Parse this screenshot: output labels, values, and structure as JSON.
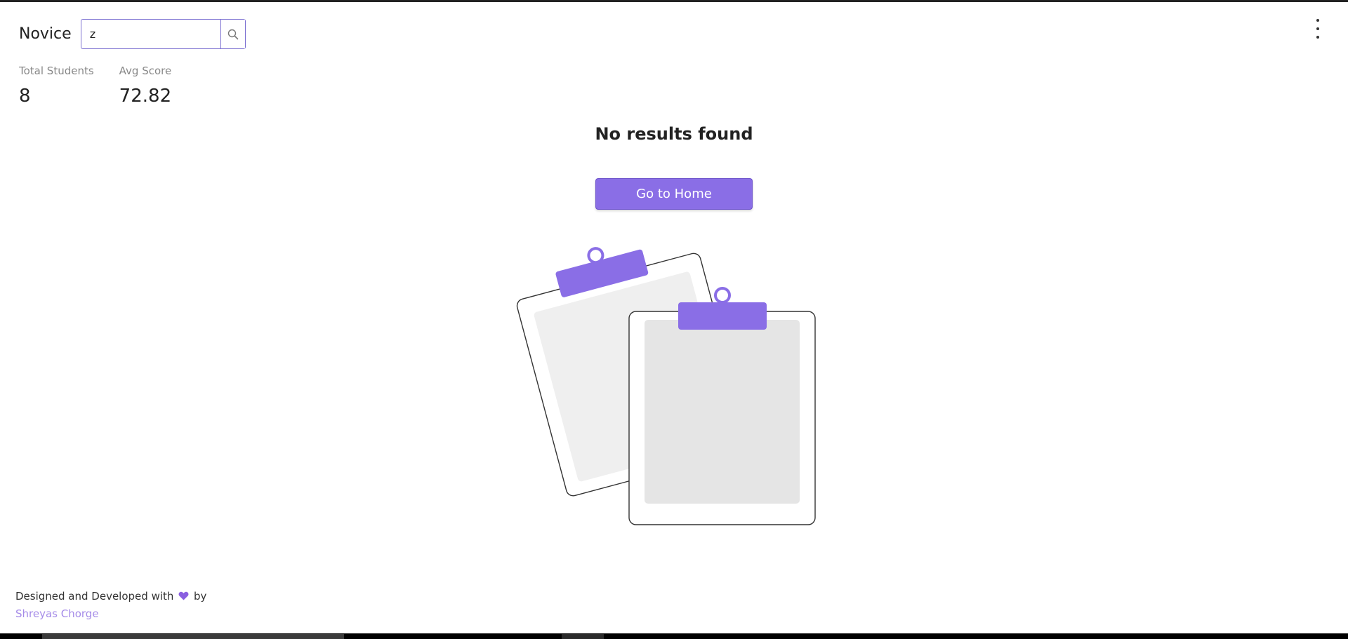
{
  "header": {
    "brand": "Novice",
    "search": {
      "value": "z",
      "placeholder": ""
    }
  },
  "stats": [
    {
      "label": "Total Students",
      "value": "8"
    },
    {
      "label": "Avg Score",
      "value": "72.82"
    }
  ],
  "empty_state": {
    "title": "No results found",
    "button_label": "Go to Home"
  },
  "footer": {
    "text_prefix": "Designed and Developed with",
    "text_suffix": "by",
    "author": "Shreyas Chorge"
  },
  "icons": {
    "search": "search-icon",
    "menu": "kebab-menu-icon",
    "heart": "heart-icon"
  },
  "colors": {
    "accent": "#8a6ee6",
    "accent_border": "#7b6fd1",
    "link": "#a58be8"
  }
}
